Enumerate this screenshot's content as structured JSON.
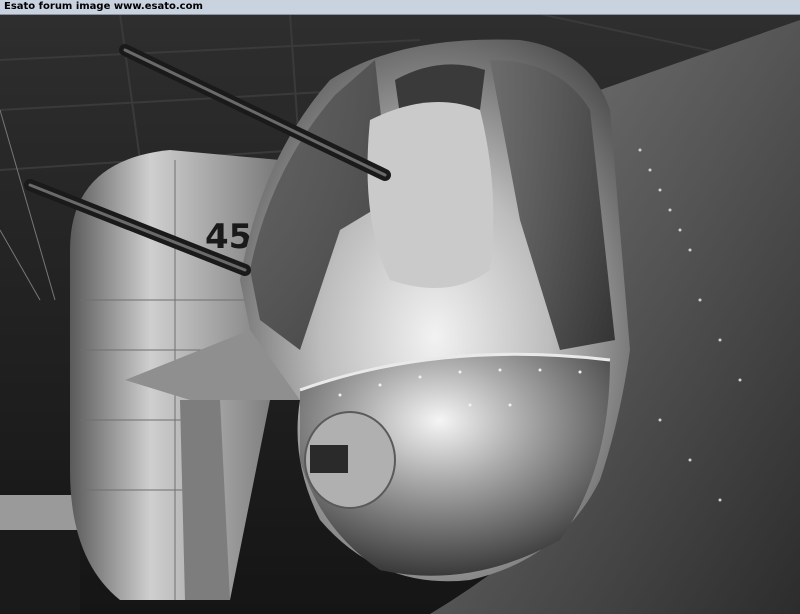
{
  "header": {
    "caption": "Esato forum image www.esato.com"
  },
  "photo": {
    "subject": "grayscale photograph of an aircraft tail gun turret with twin machine guns under a hangar roof",
    "tail_marking": "45",
    "colors": {
      "background": "#0d0d0d",
      "metal_highlight": "#e6e6e6",
      "metal_mid": "#8c8c8c",
      "header_bar": "#c9d3e0"
    }
  }
}
